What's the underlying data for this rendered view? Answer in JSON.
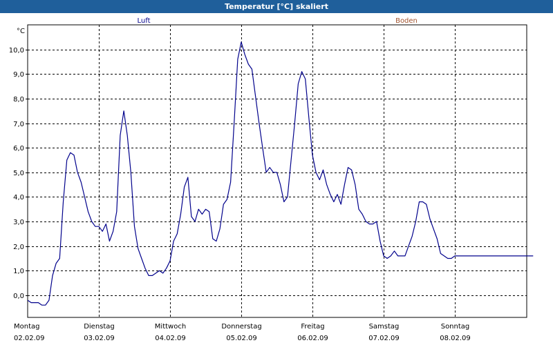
{
  "window": {
    "title": "Temperatur [°C] skaliert"
  },
  "colors": {
    "titlebar": "#1f5f9b",
    "luft": "#00008b",
    "boden": "#a0522d",
    "grid": "#000000"
  },
  "chart_data": {
    "type": "line",
    "title": "Temperatur [°C] skaliert",
    "ylabel": "°C",
    "xlabel": "",
    "ylim": [
      -0.9,
      11.0
    ],
    "yticks": [
      0,
      1,
      2,
      3,
      4,
      5,
      6,
      7,
      8,
      9,
      10
    ],
    "ytick_labels": [
      "0,0",
      "1,0",
      "2,0",
      "3,0",
      "4,0",
      "5,0",
      "6,0",
      "7,0",
      "8,0",
      "9,0",
      "10,0"
    ],
    "xlim": [
      0,
      7.18
    ],
    "grid": true,
    "legend": [
      "Luft",
      "Boden"
    ],
    "legend_placement": "top",
    "days": [
      {
        "name": "Montag",
        "date": "02.02.09"
      },
      {
        "name": "Dienstag",
        "date": "03.02.09"
      },
      {
        "name": "Mittwoch",
        "date": "04.02.09"
      },
      {
        "name": "Donnerstag",
        "date": "05.02.09"
      },
      {
        "name": "Freitag",
        "date": "06.02.09"
      },
      {
        "name": "Samstag",
        "date": "07.02.09"
      },
      {
        "name": "Sonntag",
        "date": "08.02.09"
      }
    ],
    "series": [
      {
        "name": "Luft",
        "x": [
          0.0,
          0.05,
          0.1,
          0.15,
          0.2,
          0.25,
          0.3,
          0.35,
          0.4,
          0.45,
          0.5,
          0.55,
          0.6,
          0.65,
          0.7,
          0.75,
          0.8,
          0.85,
          0.9,
          0.95,
          1.0,
          1.05,
          1.1,
          1.15,
          1.2,
          1.25,
          1.3,
          1.35,
          1.4,
          1.45,
          1.5,
          1.55,
          1.6,
          1.65,
          1.7,
          1.75,
          1.8,
          1.85,
          1.9,
          1.95,
          2.0,
          2.05,
          2.1,
          2.15,
          2.2,
          2.25,
          2.3,
          2.35,
          2.4,
          2.45,
          2.5,
          2.55,
          2.6,
          2.65,
          2.7,
          2.75,
          2.8,
          2.85,
          2.9,
          2.95,
          3.0,
          3.05,
          3.1,
          3.15,
          3.2,
          3.25,
          3.3,
          3.35,
          3.4,
          3.45,
          3.5,
          3.55,
          3.6,
          3.65,
          3.7,
          3.75,
          3.8,
          3.85,
          3.9,
          3.95,
          4.0,
          4.05,
          4.1,
          4.15,
          4.2,
          4.25,
          4.3,
          4.35,
          4.4,
          4.45,
          4.5,
          4.55,
          4.6,
          4.65,
          4.7,
          4.75,
          4.8,
          4.85,
          4.9,
          4.95,
          5.0,
          5.05,
          5.1,
          5.15,
          5.2,
          5.25,
          5.3,
          5.35,
          5.4,
          5.45,
          5.5,
          5.55,
          5.6,
          5.65,
          5.7,
          5.75,
          5.8,
          5.85,
          5.9,
          5.95,
          6.0,
          6.05,
          6.1,
          6.15,
          6.2,
          6.25,
          6.3,
          6.35,
          6.4,
          6.45,
          6.5,
          6.55,
          6.6,
          6.65,
          6.7,
          6.75,
          6.8,
          6.85,
          6.9,
          6.95,
          7.0,
          7.05,
          7.1
        ],
        "values": [
          -0.2,
          -0.3,
          -0.3,
          -0.3,
          -0.4,
          -0.4,
          -0.2,
          0.8,
          1.3,
          1.5,
          3.8,
          5.5,
          5.8,
          5.7,
          5.0,
          4.6,
          4.0,
          3.4,
          3.0,
          2.8,
          2.8,
          2.6,
          2.9,
          2.2,
          2.6,
          3.4,
          6.5,
          7.5,
          6.5,
          5.0,
          2.8,
          1.9,
          1.5,
          1.1,
          0.8,
          0.8,
          0.9,
          1.0,
          0.9,
          1.1,
          1.4,
          2.2,
          2.5,
          3.3,
          4.4,
          4.8,
          3.2,
          3.0,
          3.5,
          3.3,
          3.5,
          3.4,
          2.3,
          2.2,
          2.7,
          3.7,
          3.9,
          4.6,
          7.0,
          9.6,
          10.3,
          9.8,
          9.4,
          9.2,
          8.1,
          7.0,
          6.0,
          5.0,
          5.2,
          5.0,
          5.0,
          4.5,
          3.8,
          4.0,
          5.5,
          7.0,
          8.6,
          9.1,
          8.8,
          7.2,
          5.7,
          5.0,
          4.7,
          5.1,
          4.5,
          4.1,
          3.8,
          4.1,
          3.7,
          4.5,
          5.2,
          5.1,
          4.5,
          3.5,
          3.3,
          3.0,
          2.9,
          2.9,
          3.0,
          2.2,
          1.6,
          1.5,
          1.6,
          1.8,
          1.6,
          1.6,
          1.6,
          2.0,
          2.4,
          3.0,
          3.8,
          3.8,
          3.7,
          3.1,
          2.7,
          2.3,
          1.7,
          1.6,
          1.5,
          1.5,
          1.6,
          1.6,
          1.6,
          1.6,
          1.6,
          1.6,
          1.6,
          1.6,
          1.6,
          1.6,
          1.6,
          1.6,
          1.6,
          1.6,
          1.6,
          1.6,
          1.6,
          1.6,
          1.6,
          1.6,
          1.6,
          1.6,
          1.6
        ]
      }
    ]
  }
}
